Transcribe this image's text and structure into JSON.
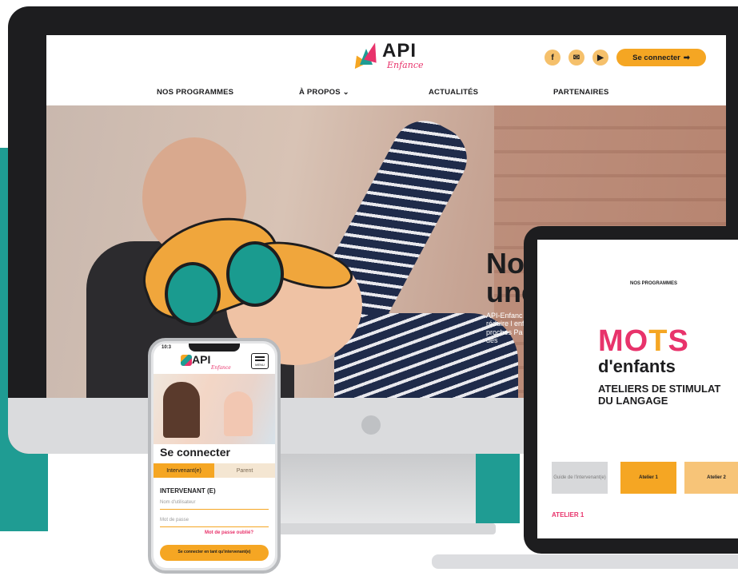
{
  "site": {
    "logo_text": "API",
    "logo_sub": "Enfance",
    "connect_label": "Se connecter",
    "social_icons": [
      "facebook-icon",
      "email-icon",
      "youtube-icon"
    ],
    "nav": [
      "NOS PROGRAMMES",
      "À PROPOS",
      "ACTUALITÉS",
      "PARTENAIRES"
    ],
    "hero_title_l1": "No",
    "hero_title_l2": "une",
    "hero_text": "API-Enfanc et réduire l enfants en proches Pa de vie des"
  },
  "tablet": {
    "nav": "NOS PROGRAMMES",
    "title_mo": "MO",
    "title_t": "T",
    "title_s": "S",
    "subtitle": "d'enfants",
    "heading_l1": "ATELIERS DE STIMULAT",
    "heading_l2": "DU LANGAGE",
    "tabs": [
      "Guide de l'intervenant(e)",
      "Atelier 1",
      "Atelier 2"
    ],
    "section": "ATELIER 1"
  },
  "phone": {
    "time": "10:3",
    "logo_text": "API",
    "logo_sub": "Enfance",
    "menu": "MENU",
    "title": "Se connecter",
    "tabs": [
      "Intervenant(e)",
      "Parent"
    ],
    "role": "INTERVENANT (E)",
    "field_user": "Nom d'utilisateur",
    "field_pass": "Mot de passe",
    "forgot": "Mot de passe oublié?",
    "button": "Se connecter en tant qu'intervenant(e)"
  },
  "colors": {
    "accent_orange": "#f5a623",
    "accent_pink": "#e8336b",
    "accent_teal": "#1f9c93"
  }
}
